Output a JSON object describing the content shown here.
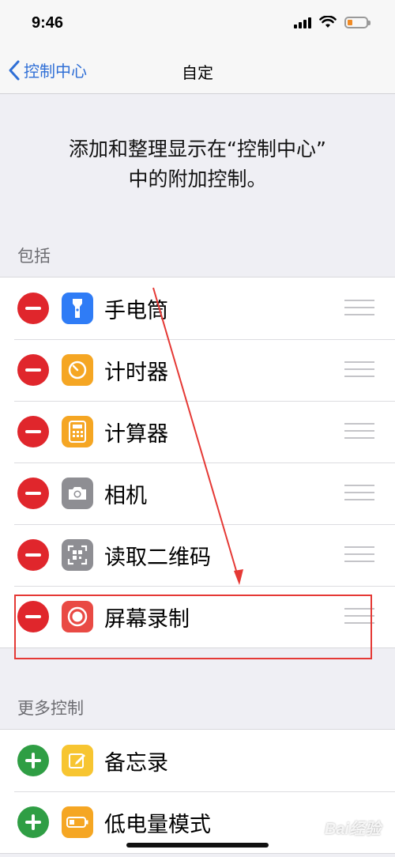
{
  "status_bar": {
    "time": "9:46",
    "battery_level": 0.25,
    "battery_color": "#f08a24"
  },
  "nav": {
    "back_label": "控制中心",
    "title": "自定"
  },
  "intro": {
    "line1": "添加和整理显示在“控制中心”",
    "line2": "中的附加控制。"
  },
  "included": {
    "header": "包括",
    "items": [
      {
        "label": "手电筒",
        "icon": "flashlight-icon",
        "color": "#2f7cf6"
      },
      {
        "label": "计时器",
        "icon": "timer-icon",
        "color": "#f5a623"
      },
      {
        "label": "计算器",
        "icon": "calculator-icon",
        "color": "#f5a623"
      },
      {
        "label": "相机",
        "icon": "camera-icon",
        "color": "#8e8e93"
      },
      {
        "label": "读取二维码",
        "icon": "qr-code-icon",
        "color": "#8e8e93"
      },
      {
        "label": "屏幕录制",
        "icon": "screen-record-icon",
        "color": "#e94a44"
      }
    ]
  },
  "more": {
    "header": "更多控制",
    "items": [
      {
        "label": "备忘录",
        "icon": "notes-icon",
        "color": "#f7c531"
      },
      {
        "label": "低电量模式",
        "icon": "low-power-icon",
        "color": "#f5a623"
      }
    ]
  },
  "colors": {
    "remove": "#e0262c",
    "add": "#2f9e44",
    "annotation": "#e53935",
    "accent": "#2f6fd6"
  },
  "watermark": "Bai经验"
}
